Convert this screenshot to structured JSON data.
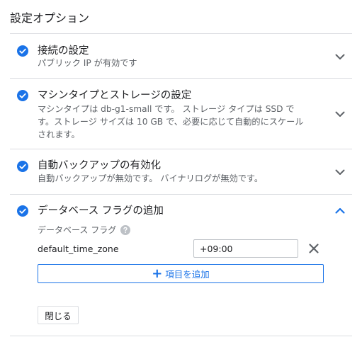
{
  "page": {
    "title": "設定オプション"
  },
  "colors": {
    "accent": "#1a73e8",
    "check": "#1a73e8",
    "divider": "#dadce0",
    "secondary_text": "#5f6368"
  },
  "sections": [
    {
      "title": "接続の設定",
      "description": "パブリック IP が有効です",
      "state": "collapsed",
      "icon": "check-circle-icon"
    },
    {
      "title": "マシンタイプとストレージの設定",
      "description": "マシンタイプは db-g1-small です。 ストレージ タイプは SSD です。ストレージ サイズは 10 GB で、必要に応じて自動的にスケールされます。",
      "state": "collapsed",
      "icon": "check-circle-icon"
    },
    {
      "title": "自動バックアップの有効化",
      "description": "自動バックアップが無効です。 バイナリログが無効です。",
      "state": "collapsed",
      "icon": "check-circle-icon"
    },
    {
      "title": "データベース フラグの追加",
      "state": "expanded",
      "icon": "check-circle-icon"
    }
  ],
  "flags": {
    "label": "データベース フラグ",
    "help_icon": "help-icon",
    "items": [
      {
        "name": "default_time_zone",
        "value": "+09:00"
      }
    ],
    "add_label": "項目を追加",
    "close_label": "閉じる"
  }
}
